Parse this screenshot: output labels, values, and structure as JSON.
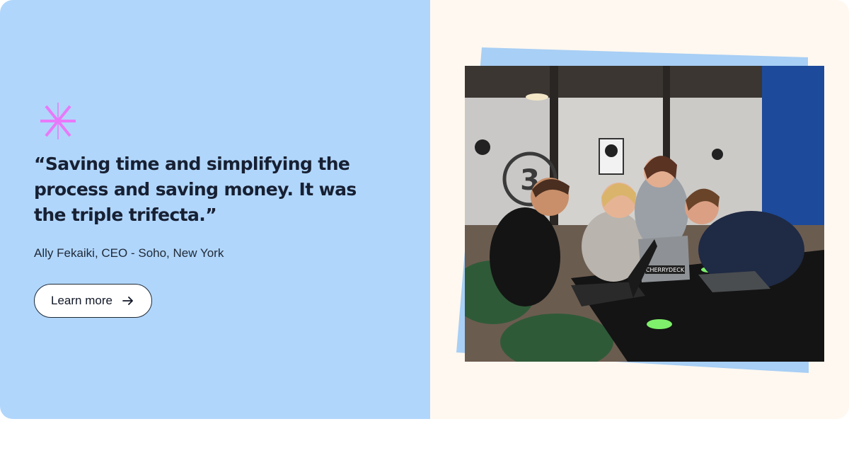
{
  "testimonial": {
    "quote": "“Saving time and simplifying the process and saving money. It was the triple trifecta.”",
    "author": "Ally Fekaiki, CEO - Soho, New York",
    "cta_label": "Learn more",
    "cta_icon": "arrow-right-icon",
    "accent_icon": "sparkle-icon"
  },
  "photo": {
    "laptop_sticker": "CHERRYDECK"
  },
  "colors": {
    "left_panel": "#b1d6fb",
    "right_panel": "#fff8f0",
    "sparkle": "#e879f9",
    "photo_frame": "#a8cff5"
  }
}
